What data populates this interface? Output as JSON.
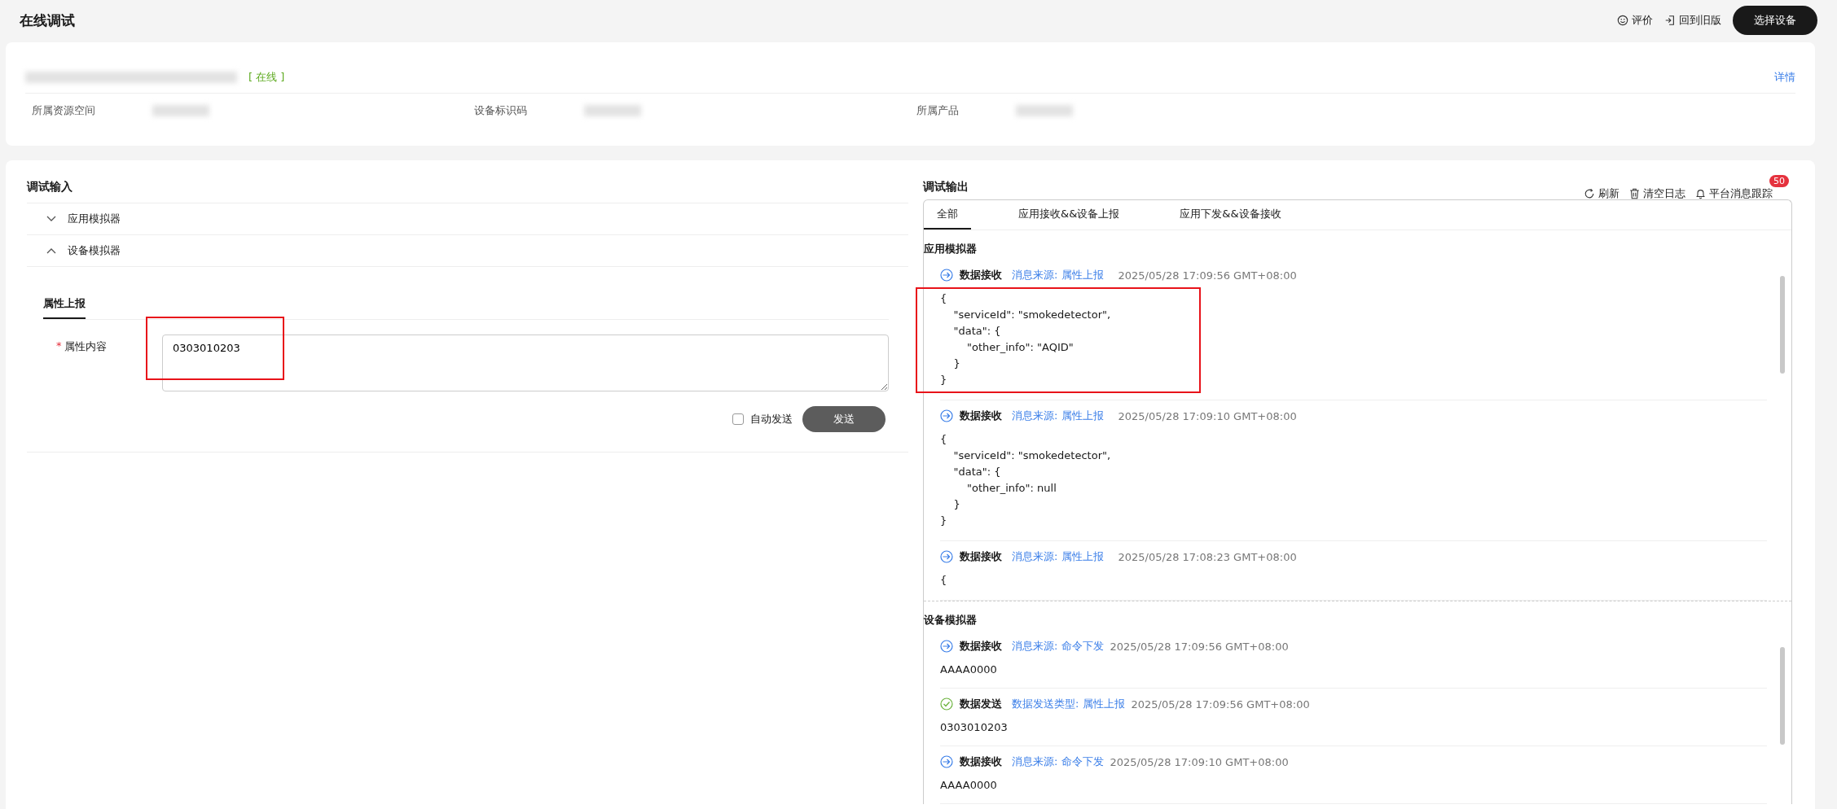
{
  "header": {
    "title": "在线调试",
    "actions": [
      {
        "kind": "rate",
        "label": "评价"
      },
      {
        "kind": "back",
        "label": "回到旧版"
      }
    ],
    "primary_button": "选择设备"
  },
  "device": {
    "status": "[ 在线 ]",
    "details_link": "详情",
    "fields": [
      {
        "label": "所属资源空间"
      },
      {
        "label": "设备标识码"
      },
      {
        "label": "所属产品"
      }
    ]
  },
  "input_panel": {
    "title": "调试输入",
    "simulators": [
      {
        "label": "应用模拟器",
        "expanded": false
      },
      {
        "label": "设备模拟器",
        "expanded": true
      }
    ],
    "tabs": [
      {
        "label": "属性上报",
        "selected": true
      }
    ],
    "field": {
      "label": "属性内容",
      "required_mark": "*",
      "value": "0303010203",
      "highlighted": true
    },
    "auto_send": {
      "label": "自动发送",
      "checked": false
    },
    "send_button": "发送"
  },
  "output_panel": {
    "title": "调试输出",
    "actions": [
      {
        "kind": "refresh",
        "label": "刷新"
      },
      {
        "kind": "clear",
        "label": "清空日志"
      },
      {
        "kind": "trace",
        "label": "平台消息跟踪",
        "badge": "50"
      }
    ],
    "tabs": [
      {
        "label": "全部",
        "selected": true
      },
      {
        "label": "应用接收&&设备上报",
        "selected": false
      },
      {
        "label": "应用下发&&设备接收",
        "selected": false
      }
    ],
    "sections": [
      {
        "title": "应用模拟器",
        "entries": [
          {
            "kind": "receive",
            "type": "数据接收",
            "source": "消息来源: 属性上报",
            "time": "2025/05/28 17:09:56 GMT+08:00",
            "body": "{\n    \"serviceId\": \"smokedetector\",\n    \"data\": {\n        \"other_info\": \"AQID\"\n    }\n}",
            "highlighted": true
          },
          {
            "kind": "receive",
            "type": "数据接收",
            "source": "消息来源: 属性上报",
            "time": "2025/05/28 17:09:10 GMT+08:00",
            "body": "{\n    \"serviceId\": \"smokedetector\",\n    \"data\": {\n        \"other_info\": null\n    }\n}"
          },
          {
            "kind": "receive",
            "type": "数据接收",
            "source": "消息来源: 属性上报",
            "time": "2025/05/28 17:08:23 GMT+08:00",
            "body": "{"
          }
        ]
      },
      {
        "title": "设备模拟器",
        "entries": [
          {
            "kind": "receive",
            "type": "数据接收",
            "source": "消息来源: 命令下发",
            "time": "2025/05/28 17:09:56 GMT+08:00",
            "body": "AAAA0000"
          },
          {
            "kind": "send",
            "type": "数据发送",
            "source": "数据发送类型: 属性上报",
            "time": "2025/05/28 17:09:56 GMT+08:00",
            "body": "0303010203"
          },
          {
            "kind": "receive",
            "type": "数据接收",
            "source": "消息来源: 命令下发",
            "time": "2025/05/28 17:09:10 GMT+08:00",
            "body": "AAAA0000"
          }
        ]
      }
    ]
  }
}
